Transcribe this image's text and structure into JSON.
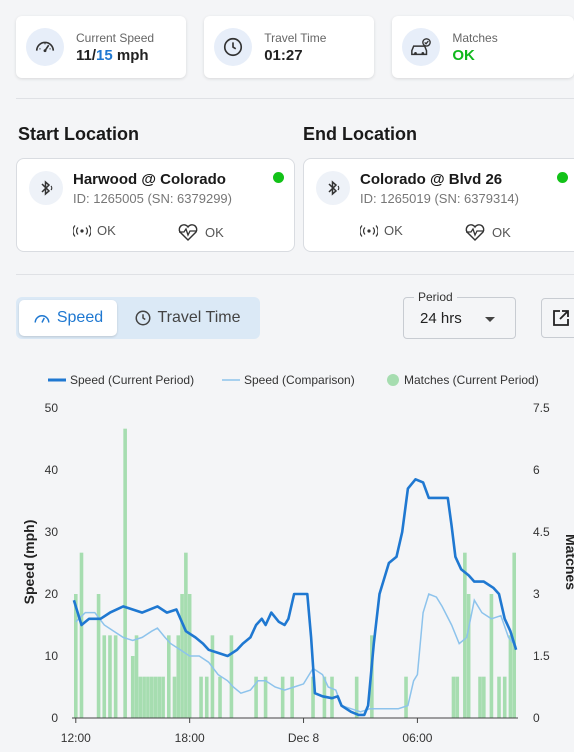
{
  "stats": [
    {
      "label": "Current Speed",
      "value_main": "11/",
      "value_total": "15",
      "value_unit": " mph",
      "icon": "speedometer-icon"
    },
    {
      "label": "Travel Time",
      "value": "01:27",
      "icon": "clock-icon"
    },
    {
      "label": "Matches",
      "value": "OK",
      "icon": "car-match-icon"
    }
  ],
  "start": {
    "title": "Start Location",
    "name": "Harwood @ Colorado",
    "ids": "ID: 1265005 (SN: 6379299)",
    "signal": "OK",
    "health": "OK"
  },
  "end": {
    "title": "End Location",
    "name": "Colorado @ Blvd 26",
    "ids": "ID: 1265019 (SN: 6379314)",
    "signal": "OK",
    "health": "OK"
  },
  "toggle": {
    "speed": "Speed",
    "travel_time": "Travel Time",
    "active": "speed"
  },
  "period": {
    "label": "Period",
    "value": "24 hrs"
  },
  "colors": {
    "accent": "#1f78d1",
    "ok_green": "#10b81c",
    "status_dot": "#12c218",
    "speed_line": "#1f78d1",
    "comparison_line": "#8dc3ec",
    "matches_bar": "#a6ddb0"
  },
  "chart_data": {
    "type": "line+bar",
    "legend": [
      "Speed (Current Period)",
      "Speed (Comparison)",
      "Matches (Current Period)"
    ],
    "y_left_label": "Speed (mph)",
    "y_right_label": "Matches",
    "y_left_ticks": [
      "0",
      "10",
      "20",
      "30",
      "40",
      "50"
    ],
    "y_right_ticks": [
      "0",
      "1.5",
      "3",
      "4.5",
      "6",
      "7.5"
    ],
    "y_left_range": [
      0,
      50
    ],
    "y_right_range": [
      0,
      7.5
    ],
    "x_tick_labels": [
      "12:00",
      "18:00",
      "Dec 8",
      "06:00"
    ],
    "x_tick_hours": [
      0,
      6,
      12,
      18
    ],
    "x_range_hours": [
      -0.2,
      23.3
    ],
    "speed_current": [
      [
        -0.1,
        19
      ],
      [
        0.3,
        15
      ],
      [
        0.7,
        16
      ],
      [
        1.3,
        16
      ],
      [
        1.8,
        17
      ],
      [
        2.5,
        18
      ],
      [
        3,
        17.5
      ],
      [
        3.5,
        17
      ],
      [
        4.3,
        18
      ],
      [
        4.8,
        17
      ],
      [
        5.3,
        17.5
      ],
      [
        5.8,
        14
      ],
      [
        6.3,
        13
      ],
      [
        6.7,
        12
      ],
      [
        7,
        11
      ],
      [
        7.5,
        10.5
      ],
      [
        8,
        10
      ],
      [
        8.5,
        11
      ],
      [
        8.8,
        12
      ],
      [
        9.2,
        13
      ],
      [
        9.5,
        15
      ],
      [
        9.8,
        16
      ],
      [
        10,
        15
      ],
      [
        10.3,
        17
      ],
      [
        10.7,
        15.5
      ],
      [
        11,
        15
      ],
      [
        11.2,
        16
      ],
      [
        11.5,
        20
      ],
      [
        12.2,
        20
      ],
      [
        12.4,
        13
      ],
      [
        12.6,
        4
      ],
      [
        13,
        3.5
      ],
      [
        13.5,
        3.2
      ],
      [
        13.8,
        3.5
      ],
      [
        14,
        2
      ],
      [
        14.5,
        1
      ],
      [
        14.9,
        0.5
      ],
      [
        15.2,
        0.5
      ],
      [
        15.4,
        2
      ],
      [
        15.7,
        12
      ],
      [
        16,
        20
      ],
      [
        16.5,
        25
      ],
      [
        16.9,
        26
      ],
      [
        17.2,
        30
      ],
      [
        17.5,
        37
      ],
      [
        17.9,
        38.5
      ],
      [
        18.3,
        38
      ],
      [
        18.6,
        35.5
      ],
      [
        19.2,
        35.5
      ],
      [
        19.6,
        35.5
      ],
      [
        19.8,
        31
      ],
      [
        20,
        26
      ],
      [
        20.3,
        24
      ],
      [
        20.7,
        23
      ],
      [
        21,
        22
      ],
      [
        21.5,
        22
      ],
      [
        22,
        21
      ],
      [
        22.3,
        20
      ],
      [
        22.6,
        16
      ],
      [
        22.9,
        14
      ],
      [
        23.2,
        11
      ]
    ],
    "speed_comparison": [
      [
        0,
        15.5
      ],
      [
        0.5,
        17
      ],
      [
        1,
        17
      ],
      [
        1.5,
        15
      ],
      [
        2,
        14
      ],
      [
        2.5,
        13
      ],
      [
        3,
        12.5
      ],
      [
        3.5,
        13
      ],
      [
        4,
        14
      ],
      [
        4.3,
        14.5
      ],
      [
        4.7,
        13
      ],
      [
        5,
        12
      ],
      [
        5.5,
        11
      ],
      [
        6,
        10
      ],
      [
        6.5,
        10
      ],
      [
        7,
        9
      ],
      [
        7.5,
        7
      ],
      [
        8,
        6
      ],
      [
        8.3,
        5
      ],
      [
        8.7,
        4
      ],
      [
        9.2,
        4.5
      ],
      [
        9.6,
        6
      ],
      [
        10,
        6
      ],
      [
        10.5,
        5
      ],
      [
        11,
        4.5
      ],
      [
        11.5,
        5
      ],
      [
        12,
        5.5
      ],
      [
        12.5,
        8
      ],
      [
        13,
        7
      ],
      [
        13.3,
        5
      ],
      [
        13.7,
        4.5
      ],
      [
        14,
        2
      ],
      [
        14.5,
        1.5
      ],
      [
        15,
        1
      ],
      [
        15.5,
        1.5
      ],
      [
        16,
        1.5
      ],
      [
        16.5,
        1.5
      ],
      [
        17,
        1.5
      ],
      [
        17.5,
        2
      ],
      [
        17.8,
        6
      ],
      [
        18,
        7
      ],
      [
        18.3,
        17
      ],
      [
        18.6,
        20
      ],
      [
        19,
        19.5
      ],
      [
        19.3,
        18
      ],
      [
        19.8,
        15
      ],
      [
        20.2,
        12
      ],
      [
        20.6,
        13
      ],
      [
        21,
        19
      ],
      [
        21.4,
        17
      ],
      [
        21.9,
        16
      ],
      [
        22.4,
        16.5
      ],
      [
        22.8,
        13
      ],
      [
        23.2,
        11.5
      ]
    ],
    "matches": [
      [
        0,
        3
      ],
      [
        0.3,
        4
      ],
      [
        1.2,
        3
      ],
      [
        1.5,
        2
      ],
      [
        1.8,
        2
      ],
      [
        2.1,
        2
      ],
      [
        2.6,
        7
      ],
      [
        3,
        1.5
      ],
      [
        3.2,
        2
      ],
      [
        3.4,
        1
      ],
      [
        3.6,
        1
      ],
      [
        3.8,
        1
      ],
      [
        4,
        1
      ],
      [
        4.2,
        1
      ],
      [
        4.4,
        1
      ],
      [
        4.6,
        1
      ],
      [
        4.9,
        2
      ],
      [
        5.2,
        1
      ],
      [
        5.4,
        2
      ],
      [
        5.6,
        3
      ],
      [
        5.8,
        4
      ],
      [
        6,
        3
      ],
      [
        6.6,
        1
      ],
      [
        6.9,
        1
      ],
      [
        7.2,
        2
      ],
      [
        7.6,
        1
      ],
      [
        8.2,
        2
      ],
      [
        9.5,
        1
      ],
      [
        10,
        1
      ],
      [
        10.9,
        1
      ],
      [
        11.4,
        1
      ],
      [
        12.5,
        1
      ],
      [
        13.1,
        1
      ],
      [
        13.5,
        1
      ],
      [
        14.8,
        1
      ],
      [
        15.6,
        2
      ],
      [
        17.4,
        1
      ],
      [
        19.9,
        1
      ],
      [
        20.1,
        1
      ],
      [
        20.5,
        4
      ],
      [
        20.7,
        3
      ],
      [
        21.3,
        1
      ],
      [
        21.5,
        1
      ],
      [
        21.9,
        3
      ],
      [
        22.3,
        1
      ],
      [
        22.6,
        1
      ],
      [
        22.9,
        2
      ],
      [
        23.1,
        4
      ]
    ]
  }
}
